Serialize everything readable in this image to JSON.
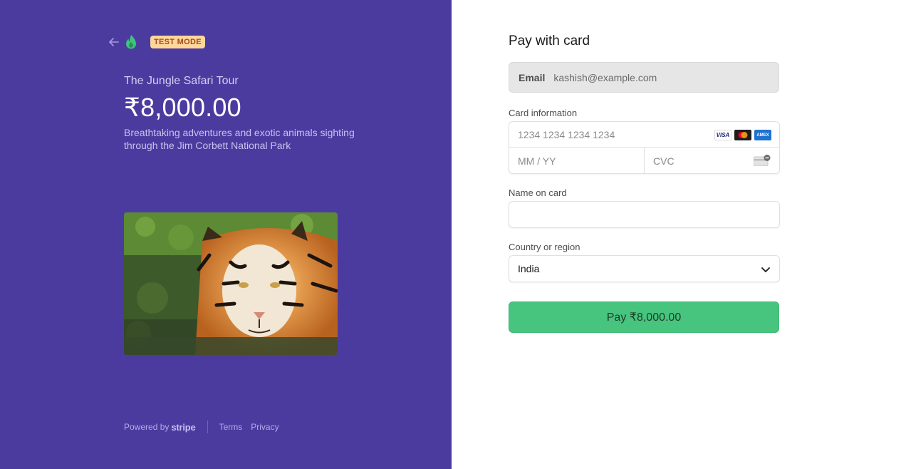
{
  "header": {
    "back_icon": "arrow-left-icon",
    "logo_icon": "flame-logo-icon",
    "badge": "TEST MODE"
  },
  "product": {
    "name": "The Jungle Safari Tour",
    "price": "₹8,000.00",
    "description": "Breathtaking adventures and exotic animals sighting through the Jim Corbett National Park",
    "image_subject": "tiger in water"
  },
  "footer": {
    "powered_by": "Powered by",
    "brand": "stripe",
    "terms": "Terms",
    "privacy": "Privacy"
  },
  "form": {
    "title": "Pay with card",
    "email_label": "Email",
    "email_value": "kashish@example.com",
    "card_info_label": "Card information",
    "card_number_placeholder": "1234 1234 1234 1234",
    "card_brands": [
      "VISA",
      "mastercard",
      "AMEX"
    ],
    "expiry_placeholder": "MM / YY",
    "cvc_placeholder": "CVC",
    "name_label": "Name on card",
    "name_value": "",
    "country_label": "Country or region",
    "country_value": "India",
    "pay_button": "Pay ₹8,000.00"
  },
  "colors": {
    "left_panel_bg": "#4c3b9f",
    "badge_bg": "#ffd79a",
    "pay_button_bg": "#47c47e"
  }
}
